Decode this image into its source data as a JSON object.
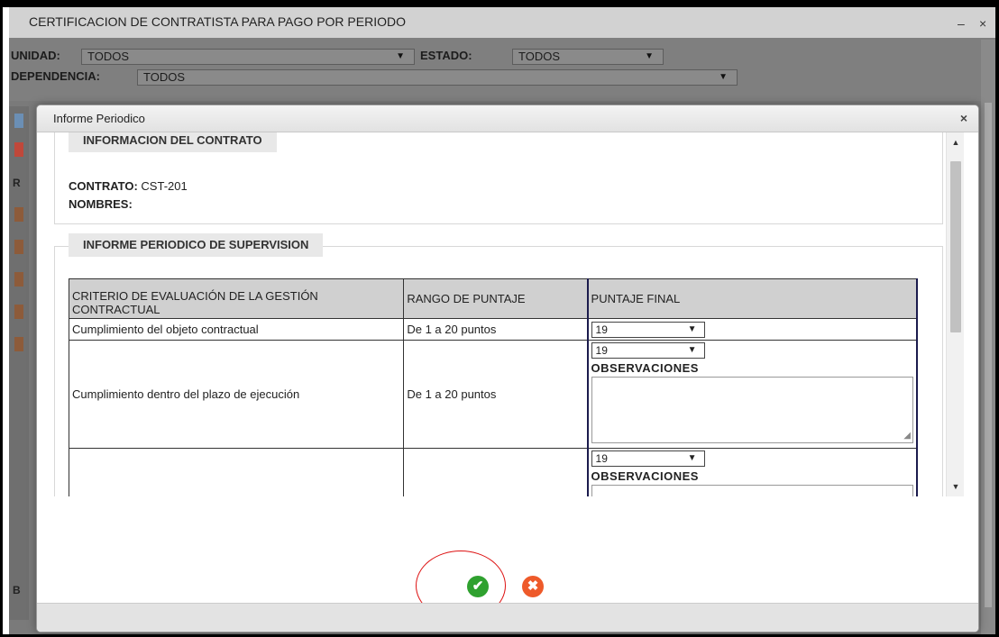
{
  "background_window": {
    "title": "CERTIFICACION DE CONTRATISTA PARA PAGO POR PERIODO",
    "minimize_glyph": "–",
    "close_glyph": "×",
    "filters": {
      "unidad_label": "UNIDAD:",
      "unidad_value": "TODOS",
      "estado_label": "ESTADO:",
      "estado_value": "TODOS",
      "dependencia_label": "DEPENDENCIA:",
      "dependencia_value": "TODOS"
    },
    "left_letters": [
      "R",
      "B"
    ]
  },
  "dialog": {
    "title": "Informe Periodico",
    "close_glyph": "×",
    "contract_section": {
      "legend": "INFORMACION DEL CONTRATO",
      "contrato_label": "CONTRATO:",
      "contrato_value": "CST-201",
      "nombres_label": "NOMBRES:",
      "nombres_value": ""
    },
    "report_section": {
      "legend": "INFORME PERIODICO DE SUPERVISION",
      "headers": {
        "criterio": "CRITERIO DE EVALUACIÓN DE LA GESTIÓN CONTRACTUAL",
        "rango": "RANGO DE PUNTAJE",
        "puntaje": "PUNTAJE FINAL"
      },
      "rows": [
        {
          "criterio": "Cumplimiento del objeto contractual",
          "rango": "De 1 a 20 puntos",
          "puntaje": "19"
        },
        {
          "criterio": "Cumplimiento dentro del plazo de ejecución",
          "rango": "De 1 a 20 puntos",
          "puntaje": "19",
          "observaciones_label": "OBSERVACIONES"
        },
        {
          "criterio": "",
          "rango": "",
          "puntaje": "19",
          "observaciones_label": "OBSERVACIONES"
        }
      ]
    },
    "buttons": {
      "accept_icon": "check-circle-icon",
      "cancel_icon": "x-circle-icon"
    }
  },
  "colors": {
    "accept": "#2fa12f",
    "cancel": "#ee5a2a",
    "highlight_circle": "#dd1111",
    "overlay": "#7a7a7a"
  }
}
